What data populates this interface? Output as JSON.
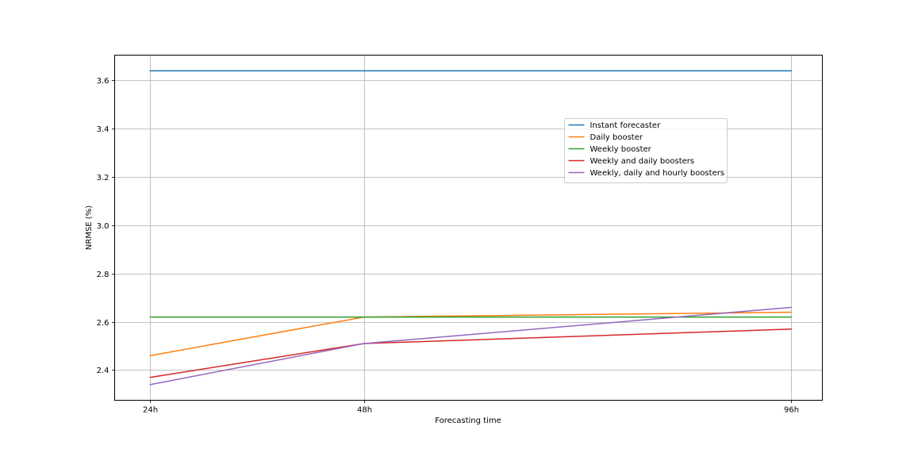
{
  "chart_data": {
    "type": "line",
    "title": "",
    "xlabel": "Forecasting time",
    "ylabel": "NRMSE (%)",
    "categories": [
      "24h",
      "48h",
      "96h"
    ],
    "x": [
      24,
      48,
      96
    ],
    "ylim": [
      2.275,
      3.705
    ],
    "yticks": [
      2.4,
      2.6,
      2.8,
      3.0,
      3.2,
      3.4,
      3.6
    ],
    "ytick_labels": [
      "2.4",
      "2.6",
      "2.8",
      "3.0",
      "3.2",
      "3.4",
      "3.6"
    ],
    "grid": true,
    "legend_position": "upper right",
    "series": [
      {
        "name": "Instant forecaster",
        "color": "#1f77b4",
        "values": [
          3.64,
          3.64,
          3.64
        ]
      },
      {
        "name": "Daily booster",
        "color": "#ff7f0e",
        "values": [
          2.46,
          2.62,
          2.64
        ]
      },
      {
        "name": "Weekly booster",
        "color": "#2ca02c",
        "values": [
          2.62,
          2.62,
          2.62
        ]
      },
      {
        "name": "Weekly and daily boosters",
        "color": "#d62728",
        "values": [
          2.37,
          2.51,
          2.57
        ]
      },
      {
        "name": "Weekly, daily and hourly boosters",
        "color": "#9467bd",
        "values": [
          2.34,
          2.51,
          2.66
        ]
      }
    ]
  }
}
